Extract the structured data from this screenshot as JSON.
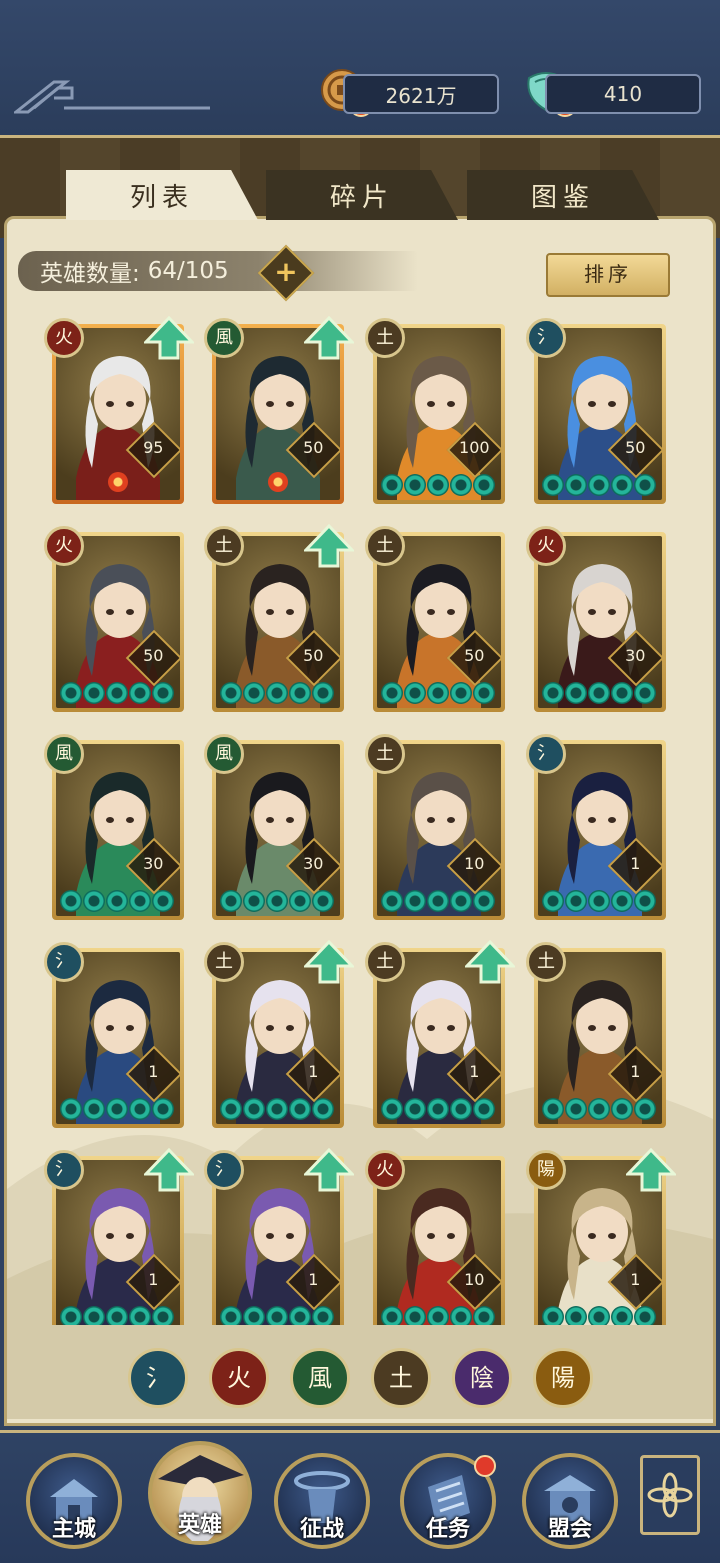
{
  "resources": {
    "coins": "2621万",
    "gems": "410"
  },
  "tabs": [
    {
      "label": "列表",
      "active": true
    },
    {
      "label": "碎片",
      "active": false
    },
    {
      "label": "图鉴",
      "active": false
    }
  ],
  "hero_count": {
    "label": "英雄数量:",
    "value": "64/105"
  },
  "sort_label": "排序",
  "elements": {
    "water": {
      "glyph": "氵",
      "color": "#1f4f60"
    },
    "fire": {
      "glyph": "火",
      "color": "#7d2218"
    },
    "wind": {
      "glyph": "風",
      "color": "#245a33"
    },
    "earth": {
      "glyph": "土",
      "color": "#4c3b22"
    },
    "yin": {
      "glyph": "陰",
      "color": "#4a2b6c"
    },
    "yang": {
      "glyph": "陽",
      "color": "#8a5c10"
    }
  },
  "heroes": [
    {
      "element": "fire",
      "level": "95",
      "upgrade": true,
      "stars": 0,
      "hair": "#e8e8e8",
      "cloth": "#7a1f1a",
      "frame": "orange"
    },
    {
      "element": "wind",
      "level": "50",
      "upgrade": true,
      "stars": 0,
      "hair": "#1e2a32",
      "cloth": "#3a5a4c",
      "frame": "orange"
    },
    {
      "element": "earth",
      "level": "100",
      "upgrade": false,
      "stars": 5,
      "hair": "#6b5a48",
      "cloth": "#e08a2a",
      "frame": "gold"
    },
    {
      "element": "water",
      "level": "50",
      "upgrade": false,
      "stars": 5,
      "hair": "#4a8fe0",
      "cloth": "#2c4f8a",
      "frame": "gold"
    },
    {
      "element": "fire",
      "level": "50",
      "upgrade": false,
      "stars": 5,
      "hair": "#4a4f58",
      "cloth": "#8a1f1f",
      "frame": "gold"
    },
    {
      "element": "earth",
      "level": "50",
      "upgrade": true,
      "stars": 5,
      "hair": "#2a2320",
      "cloth": "#8a5a2a",
      "frame": "gold"
    },
    {
      "element": "earth",
      "level": "50",
      "upgrade": false,
      "stars": 5,
      "hair": "#1c1c22",
      "cloth": "#c8742a",
      "frame": "gold"
    },
    {
      "element": "fire",
      "level": "30",
      "upgrade": false,
      "stars": 5,
      "hair": "#d8d4d0",
      "cloth": "#3a1a1a",
      "frame": "gold"
    },
    {
      "element": "wind",
      "level": "30",
      "upgrade": false,
      "stars": 5,
      "hair": "#1a2a2a",
      "cloth": "#2a8a5a",
      "frame": "gold"
    },
    {
      "element": "wind",
      "level": "30",
      "upgrade": false,
      "stars": 5,
      "hair": "#1a1a1e",
      "cloth": "#6a8a6a",
      "frame": "gold"
    },
    {
      "element": "earth",
      "level": "10",
      "upgrade": false,
      "stars": 5,
      "hair": "#5a5048",
      "cloth": "#2c3a5a",
      "frame": "gold"
    },
    {
      "element": "water",
      "level": "1",
      "upgrade": false,
      "stars": 5,
      "hair": "#1a2040",
      "cloth": "#3a6ab0",
      "frame": "gold"
    },
    {
      "element": "water",
      "level": "1",
      "upgrade": false,
      "stars": 5,
      "hair": "#1c2a40",
      "cloth": "#2a4a80",
      "frame": "gold"
    },
    {
      "element": "earth",
      "level": "1",
      "upgrade": true,
      "stars": 5,
      "hair": "#e6e2ee",
      "cloth": "#2a2a40",
      "frame": "gold"
    },
    {
      "element": "earth",
      "level": "1",
      "upgrade": true,
      "stars": 5,
      "hair": "#e6e2ee",
      "cloth": "#2a2a40",
      "frame": "gold"
    },
    {
      "element": "earth",
      "level": "1",
      "upgrade": false,
      "stars": 5,
      "hair": "#2a2320",
      "cloth": "#8a5a2a",
      "frame": "gold"
    },
    {
      "element": "water",
      "level": "1",
      "upgrade": true,
      "stars": 5,
      "hair": "#7a5ab0",
      "cloth": "#2a2a4a",
      "frame": "gold"
    },
    {
      "element": "water",
      "level": "1",
      "upgrade": true,
      "stars": 5,
      "hair": "#7a5ab0",
      "cloth": "#2a2a4a",
      "frame": "gold"
    },
    {
      "element": "fire",
      "level": "10",
      "upgrade": false,
      "stars": 5,
      "hair": "#4a2a20",
      "cloth": "#b02a20",
      "frame": "gold"
    },
    {
      "element": "yang",
      "level": "1",
      "upgrade": true,
      "stars": 5,
      "hair": "#c8b48a",
      "cloth": "#e8e0c8",
      "frame": "gold"
    }
  ],
  "filters": [
    "water",
    "fire",
    "wind",
    "earth",
    "yin",
    "yang"
  ],
  "nav": [
    {
      "label": "主城",
      "active": false
    },
    {
      "label": "英雄",
      "active": true
    },
    {
      "label": "征战",
      "active": false
    },
    {
      "label": "任务",
      "active": false,
      "badge": true
    },
    {
      "label": "盟会",
      "active": false
    }
  ]
}
